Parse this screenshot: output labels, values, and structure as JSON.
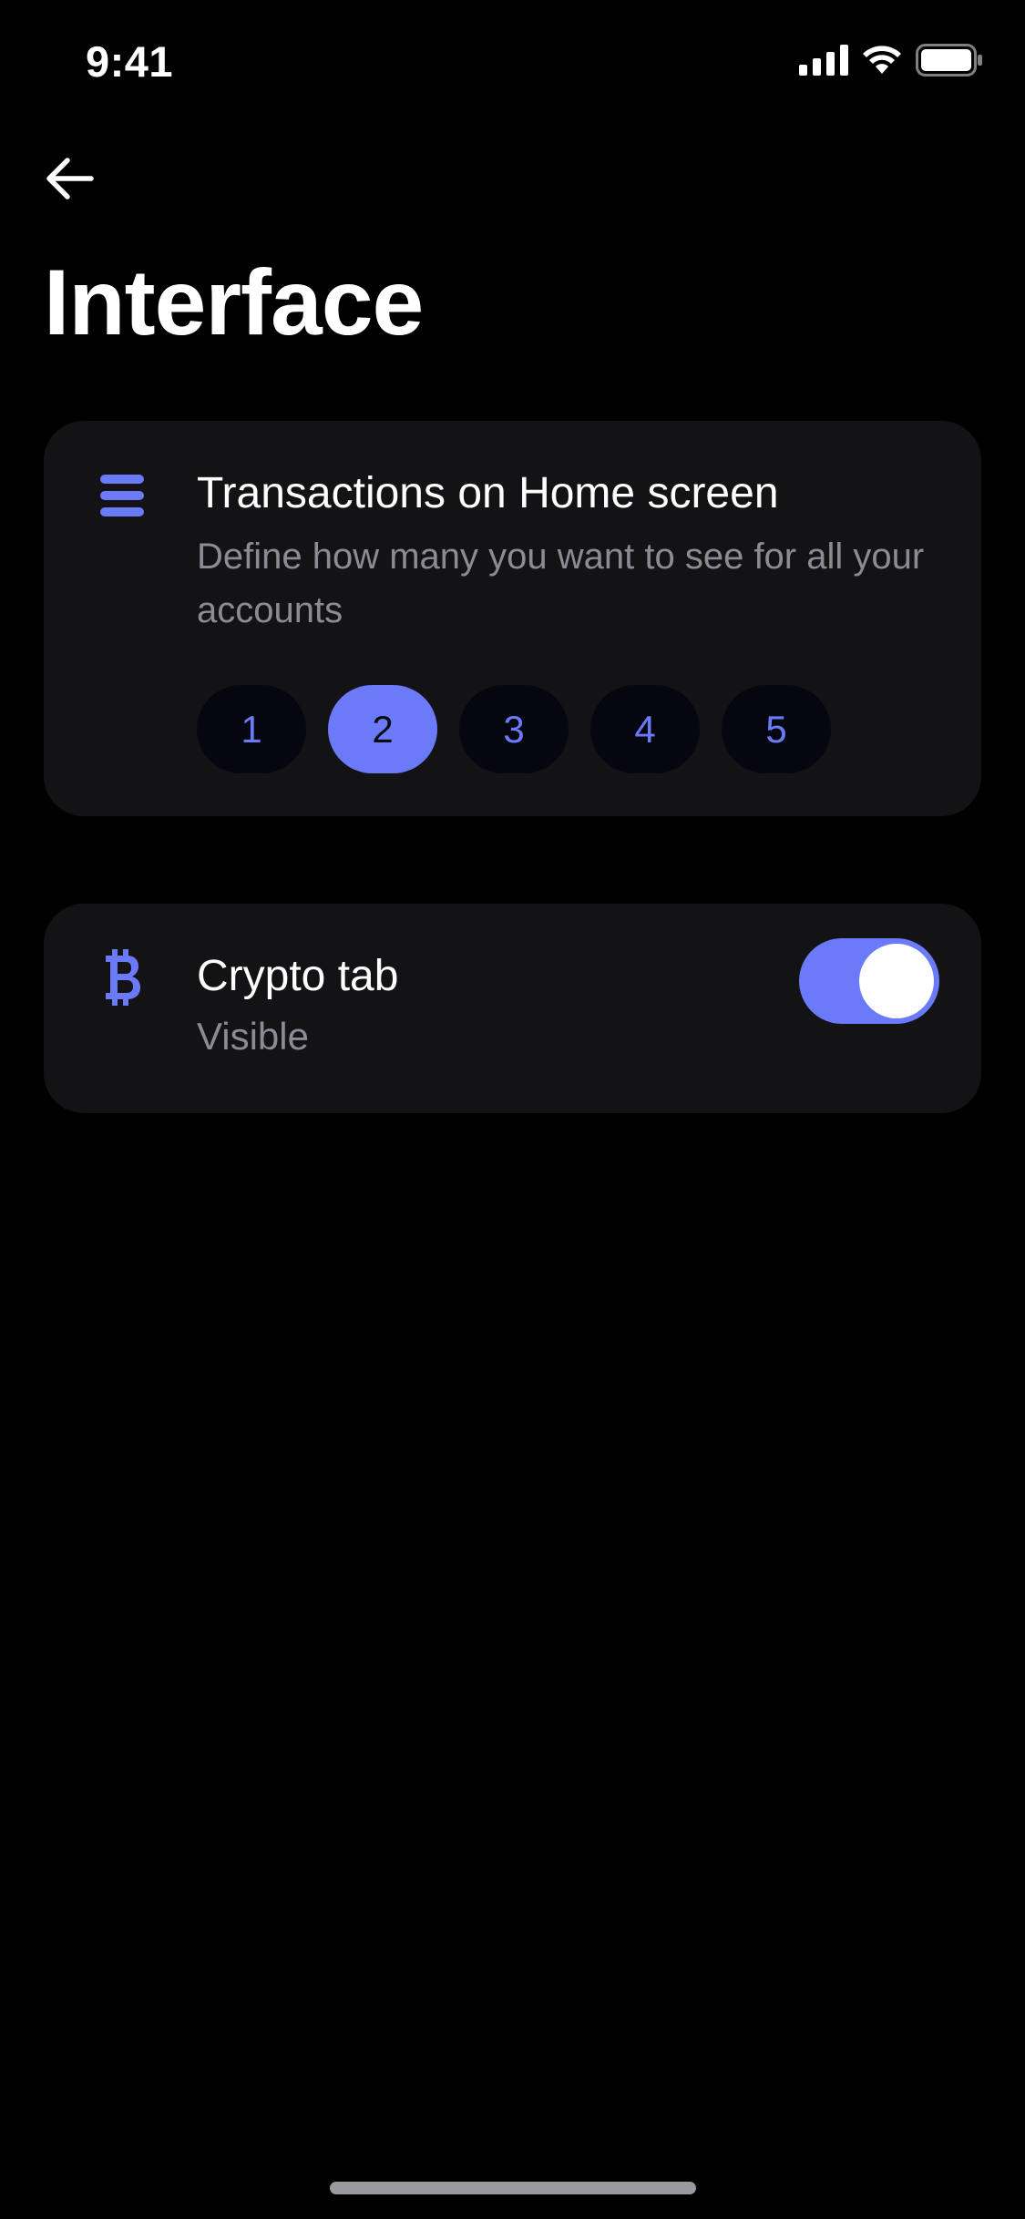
{
  "status_bar": {
    "time": "9:41"
  },
  "header": {
    "back_icon": "arrow-left-icon",
    "title": "Interface"
  },
  "transactions_card": {
    "icon": "list-lines-icon",
    "title": "Transactions on Home screen",
    "description": "Define how many you want to see for all your accounts",
    "options": [
      "1",
      "2",
      "3",
      "4",
      "5"
    ],
    "selected_option": "2"
  },
  "crypto_card": {
    "icon": "bitcoin-icon",
    "title": "Crypto tab",
    "status": "Visible",
    "toggle_on": true
  },
  "colors": {
    "background": "#000000",
    "card": "#131316",
    "accent": "#6a7af8",
    "muted_text": "#8b8b92",
    "pill_bg": "#05060f"
  }
}
